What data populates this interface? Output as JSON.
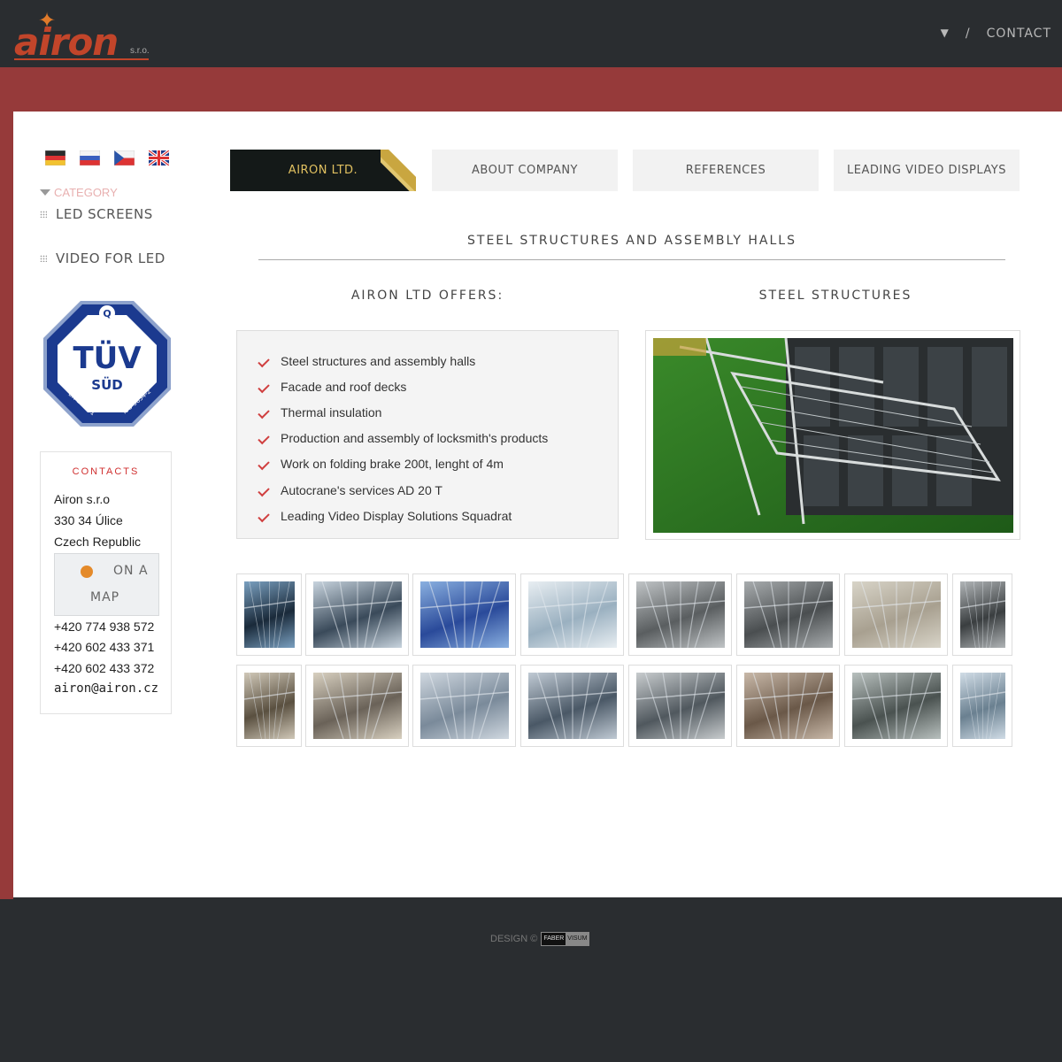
{
  "header": {
    "logo_text": "airon",
    "logo_suffix": "s.r.o.",
    "nav_caret": "▼",
    "nav_separator": "/",
    "nav_contact": "CONTACT"
  },
  "sidebar": {
    "languages": [
      "de",
      "ru",
      "cz",
      "en"
    ],
    "category_heading": "CATEGORY",
    "items": [
      {
        "label": "LED SCREENS"
      },
      {
        "label": "VIDEO FOR LED"
      }
    ],
    "badge": {
      "name": "TÜV",
      "sub": "SÜD",
      "left_text": "EN 1090-1",
      "right_text": "ISO 3834-2"
    },
    "contacts": {
      "heading": "CONTACTS",
      "company": "Airon s.r.o",
      "address1": "330 34 Úlice",
      "address2": "Czech Republic",
      "map_line1": "ON A",
      "map_line2": "MAP",
      "phone1": "+420 774 938 572",
      "phone2": "+420 602 433 371",
      "phone3": "+420 602 433 372",
      "email": "airon@airon.cz"
    }
  },
  "tabs": [
    {
      "label": "AIRON LTD."
    },
    {
      "label": "ABOUT COMPANY"
    },
    {
      "label": "REFERENCES"
    },
    {
      "label": "LEADING VIDEO DISPLAYS"
    }
  ],
  "main": {
    "title": "STEEL STRUCTURES AND ASSEMBLY HALLS",
    "offers_title": "AIRON LTD OFFERS:",
    "feature_title": "STEEL STRUCTURES",
    "offers": [
      "Steel structures and assembly halls",
      "Facade and roof decks",
      "Thermal insulation",
      "Production and assembly of locksmith's products",
      "Work on folding brake 200t, lenght of 4m",
      "Autocrane's services AD 20 T",
      "Leading Video Display Solutions Squadrat"
    ]
  },
  "colors": {
    "brand_red": "#963a3a",
    "dark": "#2a2d30",
    "accent_gold": "#e0c060",
    "check_red": "#d04040"
  },
  "footer": {
    "design_label": "DESIGN ©",
    "brand_a": "FABER",
    "brand_b": "VISUM"
  }
}
